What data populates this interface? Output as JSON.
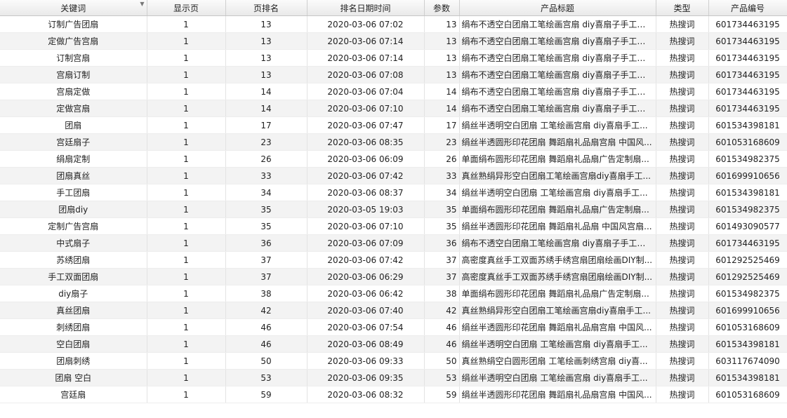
{
  "columns": [
    "关键词",
    "显示页",
    "页排名",
    "排名日期时间",
    "参数",
    "产品标题",
    "类型",
    "产品编号"
  ],
  "rows": [
    [
      "订制广告团扇",
      "1",
      "13",
      "2020-03-06 07:02",
      "13",
      "绢布不透空白团扇工笔绘画宫扇 diy喜扇子手工制...",
      "热搜词",
      "601734463195"
    ],
    [
      "定做广告宫扇",
      "1",
      "13",
      "2020-03-06 07:14",
      "13",
      "绢布不透空白团扇工笔绘画宫扇 diy喜扇子手工制...",
      "热搜词",
      "601734463195"
    ],
    [
      "订制宫扇",
      "1",
      "13",
      "2020-03-06 07:14",
      "13",
      "绢布不透空白团扇工笔绘画宫扇 diy喜扇子手工制...",
      "热搜词",
      "601734463195"
    ],
    [
      "宫扇订制",
      "1",
      "13",
      "2020-03-06 07:08",
      "13",
      "绢布不透空白团扇工笔绘画宫扇 diy喜扇子手工制...",
      "热搜词",
      "601734463195"
    ],
    [
      "宫扇定做",
      "1",
      "14",
      "2020-03-06 07:04",
      "14",
      "绢布不透空白团扇工笔绘画宫扇 diy喜扇子手工制...",
      "热搜词",
      "601734463195"
    ],
    [
      "定做宫扇",
      "1",
      "14",
      "2020-03-06 07:10",
      "14",
      "绢布不透空白团扇工笔绘画宫扇 diy喜扇子手工制...",
      "热搜词",
      "601734463195"
    ],
    [
      "团扇",
      "1",
      "17",
      "2020-03-06 07:47",
      "17",
      "绢丝半透明空白团扇 工笔绘画宫扇 diy喜扇手工...",
      "热搜词",
      "601534398181"
    ],
    [
      "宫廷扇子",
      "1",
      "23",
      "2020-03-06 08:35",
      "23",
      "绢丝半透圆形印花团扇 舞蹈扇礼品扇宫扇 中国风...",
      "热搜词",
      "601053168609"
    ],
    [
      "绢扇定制",
      "1",
      "26",
      "2020-03-06 06:09",
      "26",
      "单面绢布圆形印花团扇 舞蹈扇礼品扇广告定制扇...",
      "热搜词",
      "601534982375"
    ],
    [
      "团扇真丝",
      "1",
      "33",
      "2020-03-06 07:42",
      "33",
      "真丝熟绢异形空白团扇工笔绘画宫扇diy喜扇手工...",
      "热搜词",
      "601699910656"
    ],
    [
      "手工团扇",
      "1",
      "34",
      "2020-03-06 08:37",
      "34",
      "绢丝半透明空白团扇 工笔绘画宫扇 diy喜扇手工...",
      "热搜词",
      "601534398181"
    ],
    [
      "团扇diy",
      "1",
      "35",
      "2020-03-05 19:03",
      "35",
      "单面绢布圆形印花团扇 舞蹈扇礼品扇广告定制扇...",
      "热搜词",
      "601534982375"
    ],
    [
      "定制广告宫扇",
      "1",
      "35",
      "2020-03-06 07:10",
      "35",
      "绢丝半透圆形印花团扇 舞蹈扇礼品扇 中国风宫扇...",
      "热搜词",
      "601493090577"
    ],
    [
      "中式扇子",
      "1",
      "36",
      "2020-03-06 07:09",
      "36",
      "绢布不透空白团扇工笔绘画宫扇 diy喜扇子手工制...",
      "热搜词",
      "601734463195"
    ],
    [
      "苏绣团扇",
      "1",
      "37",
      "2020-03-06 07:42",
      "37",
      "高密度真丝手工双面苏绣手绣宫扇团扇绘画DIY制...",
      "热搜词",
      "601292525469"
    ],
    [
      "手工双面团扇",
      "1",
      "37",
      "2020-03-06 06:29",
      "37",
      "高密度真丝手工双面苏绣手绣宫扇团扇绘画DIY制...",
      "热搜词",
      "601292525469"
    ],
    [
      "diy扇子",
      "1",
      "38",
      "2020-03-06 06:42",
      "38",
      "单面绢布圆形印花团扇 舞蹈扇礼品扇广告定制扇...",
      "热搜词",
      "601534982375"
    ],
    [
      "真丝团扇",
      "1",
      "42",
      "2020-03-06 07:40",
      "42",
      "真丝熟绢异形空白团扇工笔绘画宫扇diy喜扇手工...",
      "热搜词",
      "601699910656"
    ],
    [
      "刺绣团扇",
      "1",
      "46",
      "2020-03-06 07:54",
      "46",
      "绢丝半透圆形印花团扇 舞蹈扇礼品扇宫扇 中国风...",
      "热搜词",
      "601053168609"
    ],
    [
      "空白团扇",
      "1",
      "46",
      "2020-03-06 08:49",
      "46",
      "绢丝半透明空白团扇 工笔绘画宫扇 diy喜扇手工...",
      "热搜词",
      "601534398181"
    ],
    [
      "团扇刺绣",
      "1",
      "50",
      "2020-03-06 09:33",
      "50",
      "真丝熟绢空白圆形团扇 工笔绘画刺绣宫扇 diy喜...",
      "热搜词",
      "603117674090"
    ],
    [
      "团扇 空白",
      "1",
      "53",
      "2020-03-06 09:35",
      "53",
      "绢丝半透明空白团扇 工笔绘画宫扇 diy喜扇手工...",
      "热搜词",
      "601534398181"
    ],
    [
      "宫廷扇",
      "1",
      "59",
      "2020-03-06 08:32",
      "59",
      "绢丝半透圆形印花团扇 舞蹈扇礼品扇宫扇 中国风...",
      "热搜词",
      "601053168609"
    ]
  ]
}
